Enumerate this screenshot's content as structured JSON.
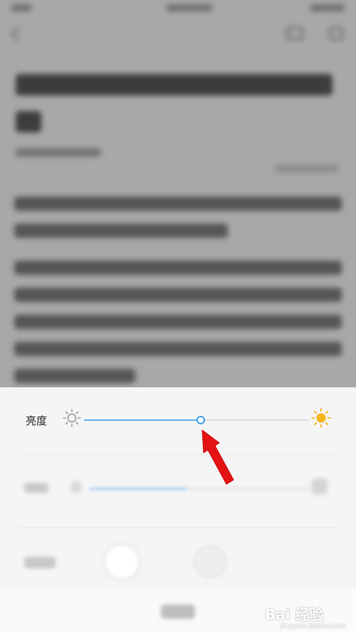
{
  "brightness": {
    "label": "亮度",
    "level": 0.52,
    "accent_color": "#3f9ee8",
    "min_icon": "sun-small-icon",
    "max_icon": "sun-large-icon",
    "max_icon_color": "#f5b51b"
  },
  "annotation": {
    "type": "red-arrow",
    "color": "#e41414",
    "points_to": "brightness-slider-thumb"
  },
  "watermark": {
    "logo_text": "Bai 经验",
    "url_text": "jingyan.baidu.com"
  }
}
